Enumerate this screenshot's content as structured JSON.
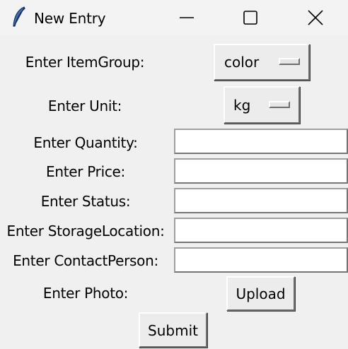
{
  "window": {
    "title": "New Entry",
    "icon": "feather-icon"
  },
  "form": {
    "item_group": {
      "label": "Enter ItemGroup:",
      "value": "color"
    },
    "unit": {
      "label": "Enter Unit:",
      "value": "kg"
    },
    "quantity": {
      "label": "Enter Quantity:",
      "value": ""
    },
    "price": {
      "label": "Enter Price:",
      "value": ""
    },
    "status": {
      "label": "Enter Status:",
      "value": ""
    },
    "storage_location": {
      "label": "Enter StorageLocation:",
      "value": ""
    },
    "contact_person": {
      "label": "Enter ContactPerson:",
      "value": ""
    },
    "photo": {
      "label": "Enter Photo:",
      "button": "Upload"
    },
    "submit": "Submit"
  }
}
